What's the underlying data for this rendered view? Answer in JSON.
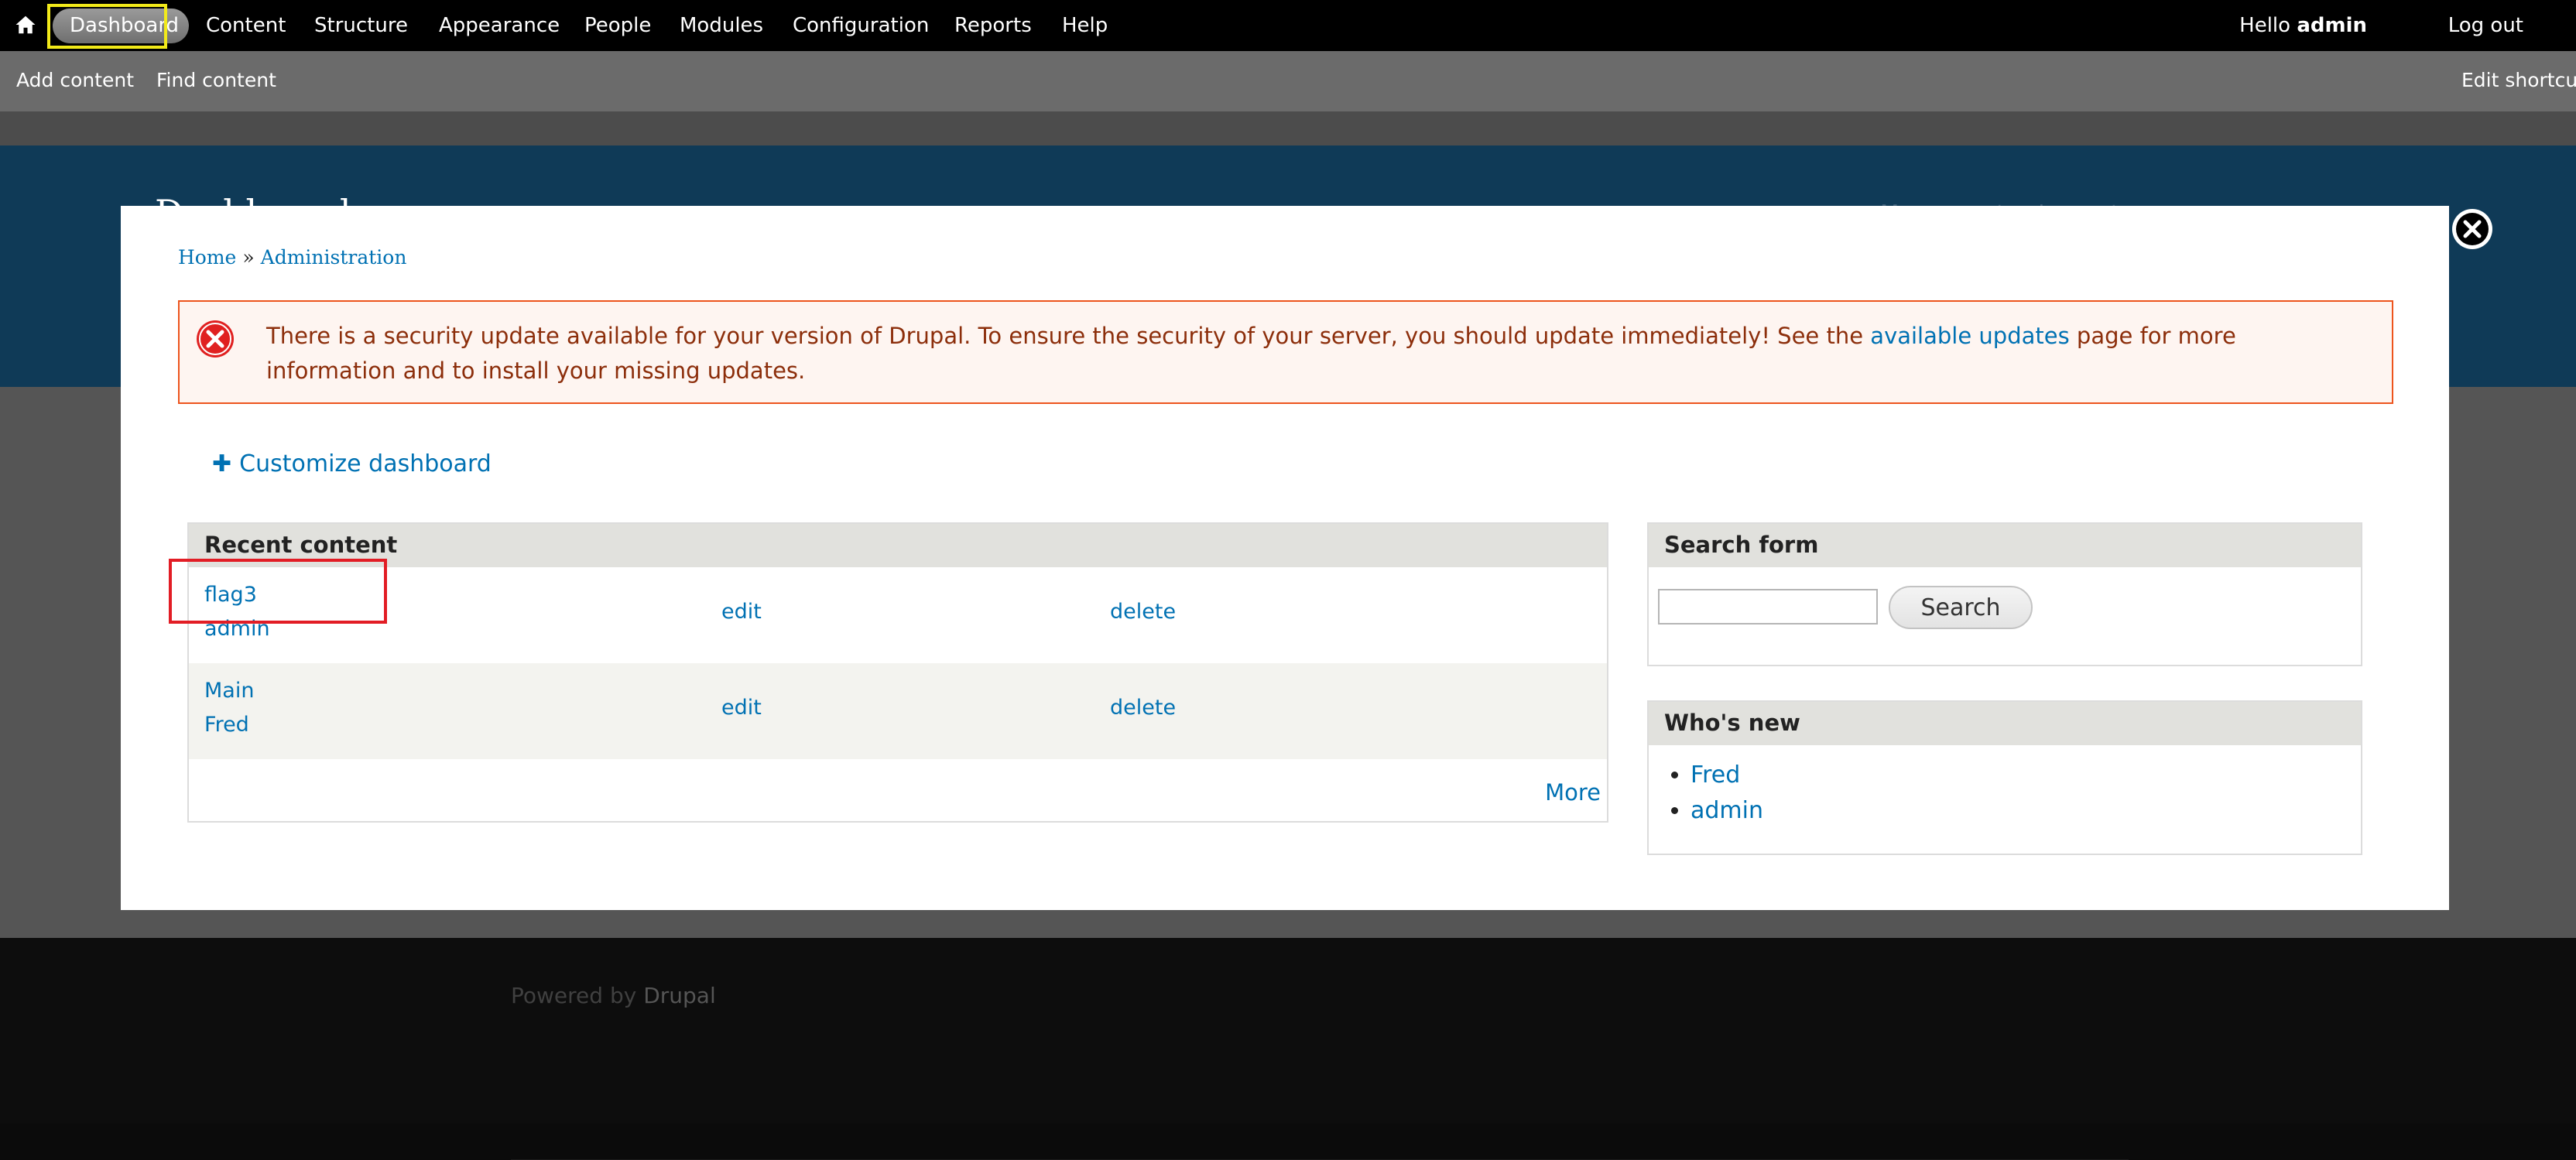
{
  "toolbar": {
    "home_icon": "home-icon",
    "items": [
      {
        "label": "Dashboard",
        "active": true
      },
      {
        "label": "Content"
      },
      {
        "label": "Structure"
      },
      {
        "label": "Appearance"
      },
      {
        "label": "People"
      },
      {
        "label": "Modules"
      },
      {
        "label": "Configuration"
      },
      {
        "label": "Reports"
      },
      {
        "label": "Help"
      }
    ],
    "hello_prefix": "Hello",
    "username": "admin",
    "logout": "Log out"
  },
  "shortcuts": {
    "add_content": "Add content",
    "find_content": "Find content",
    "edit_shortcuts": "Edit shortcuts"
  },
  "page": {
    "title": "Dashboard",
    "secondary_menu": [
      "My account",
      "Log out"
    ],
    "powered_prefix": "Powered by",
    "powered_link": "Drupal"
  },
  "overlay": {
    "breadcrumb": [
      "Home",
      "Administration"
    ],
    "breadcrumb_sep": "»",
    "alert": {
      "text_before": "There is a security update available for your version of Drupal. To ensure the security of your server, you should update immediately! See the",
      "link": "available updates",
      "text_after": "page for more information and to install your missing updates."
    },
    "customize_label": "Customize dashboard",
    "recent_content": {
      "title": "Recent content",
      "rows": [
        {
          "title": "flag3",
          "author": "admin",
          "edit": "edit",
          "delete": "delete"
        },
        {
          "title": "Main",
          "author": "Fred",
          "edit": "edit",
          "delete": "delete"
        }
      ],
      "more": "More"
    },
    "search_form": {
      "title": "Search form",
      "value": "",
      "button": "Search"
    },
    "whos_new": {
      "title": "Who's new",
      "users": [
        "Fred",
        "admin"
      ]
    }
  },
  "colors": {
    "link": "#0071b3",
    "alert_border": "#ed541d",
    "alert_text": "#8c2e0b",
    "header_band": "#0f3a57"
  }
}
